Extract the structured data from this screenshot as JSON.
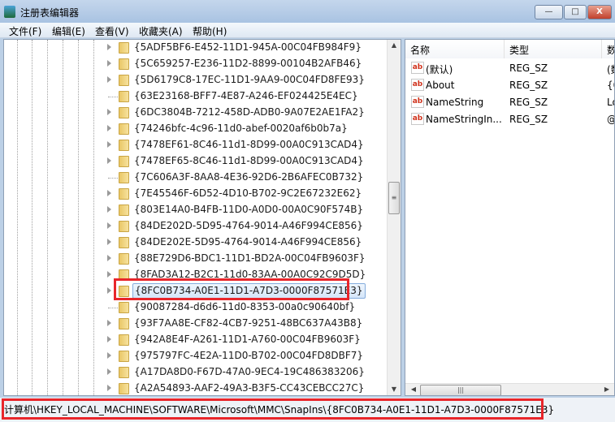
{
  "window": {
    "title": "注册表编辑器",
    "minimize": "—",
    "maximize": "□",
    "close": "X"
  },
  "menu": [
    "文件(F)",
    "编辑(E)",
    "查看(V)",
    "收藏夹(A)",
    "帮助(H)"
  ],
  "tree": {
    "items": [
      {
        "label": "{5ADF5BF6-E452-11D1-945A-00C04FB984F9}",
        "expandable": true
      },
      {
        "label": "{5C659257-E236-11D2-8899-00104B2AFB46}",
        "expandable": true
      },
      {
        "label": "{5D6179C8-17EC-11D1-9AA9-00C04FD8FE93}",
        "expandable": true
      },
      {
        "label": "{63E23168-BFF7-4E87-A246-EF024425E4EC}",
        "expandable": false
      },
      {
        "label": "{6DC3804B-7212-458D-ADB0-9A07E2AE1FA2}",
        "expandable": true
      },
      {
        "label": "{74246bfc-4c96-11d0-abef-0020af6b0b7a}",
        "expandable": true
      },
      {
        "label": "{7478EF61-8C46-11d1-8D99-00A0C913CAD4}",
        "expandable": true
      },
      {
        "label": "{7478EF65-8C46-11d1-8D99-00A0C913CAD4}",
        "expandable": true
      },
      {
        "label": "{7C606A3F-8AA8-4E36-92D6-2B6AFEC0B732}",
        "expandable": false
      },
      {
        "label": "{7E45546F-6D52-4D10-B702-9C2E67232E62}",
        "expandable": true
      },
      {
        "label": "{803E14A0-B4FB-11D0-A0D0-00A0C90F574B}",
        "expandable": true
      },
      {
        "label": "{84DE202D-5D95-4764-9014-A46F994CE856}",
        "expandable": true
      },
      {
        "label": "{84DE202E-5D95-4764-9014-A46F994CE856}",
        "expandable": true
      },
      {
        "label": "{88E729D6-BDC1-11D1-BD2A-00C04FB9603F}",
        "expandable": true
      },
      {
        "label": "{8FAD3A12-B2C1-11d0-83AA-00A0C92C9D5D}",
        "expandable": true
      },
      {
        "label": "{8FC0B734-A0E1-11D1-A7D3-0000F87571E3}",
        "expandable": true,
        "selected": true
      },
      {
        "label": "{90087284-d6d6-11d0-8353-00a0c90640bf}",
        "expandable": false
      },
      {
        "label": "{93F7AA8E-CF82-4CB7-9251-48BC637A43B8}",
        "expandable": true
      },
      {
        "label": "{942A8E4F-A261-11D1-A760-00C04FB9603F}",
        "expandable": true
      },
      {
        "label": "{975797FC-4E2A-11D0-B702-00C04FD8DBF7}",
        "expandable": true
      },
      {
        "label": "{A17DA8D0-F67D-47A0-9EC4-19C486383206}",
        "expandable": true
      },
      {
        "label": "{A2A54893-AAF2-49A3-B3F5-CC43CEBCC27C}",
        "expandable": true
      }
    ]
  },
  "values": {
    "headers": {
      "name": "名称",
      "type": "类型",
      "data": "数"
    },
    "rows": [
      {
        "name": "(默认)",
        "type": "REG_SZ",
        "data": "(数"
      },
      {
        "name": "About",
        "type": "REG_SZ",
        "data": "{0"
      },
      {
        "name": "NameString",
        "type": "REG_SZ",
        "data": "Lo"
      },
      {
        "name": "NameStringIn...",
        "type": "REG_SZ",
        "data": "@"
      }
    ]
  },
  "status": {
    "path": "计算机\\HKEY_LOCAL_MACHINE\\SOFTWARE\\Microsoft\\MMC\\SnapIns\\{8FC0B734-A0E1-11D1-A7D3-0000F87571E3}"
  },
  "colors": {
    "highlight": "#e8262b",
    "selection": "#d5e6f9"
  }
}
